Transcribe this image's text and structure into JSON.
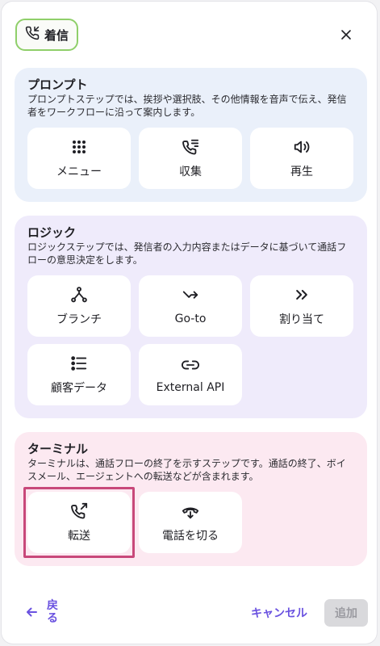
{
  "header": {
    "title": "着信"
  },
  "sections": {
    "prompt": {
      "title": "プロンプト",
      "description": "プロンプトステップでは、挨拶や選択肢、その他情報を音声で伝え、発信者をワークフローに沿って案内します。",
      "items": [
        {
          "label": "メニュー",
          "icon": "grid-dots-icon"
        },
        {
          "label": "収集",
          "icon": "phone-keypad-icon"
        },
        {
          "label": "再生",
          "icon": "speaker-icon"
        }
      ]
    },
    "logic": {
      "title": "ロジック",
      "description": "ロジックステップでは、発信者の入力内容またはデータに基づいて通話フローの意思決定をします。",
      "items": [
        {
          "label": "ブランチ",
          "icon": "branch-icon"
        },
        {
          "label": "Go-to",
          "icon": "goto-arrow-icon"
        },
        {
          "label": "割り当て",
          "icon": "double-chevron-icon"
        },
        {
          "label": "顧客データ",
          "icon": "list-icon"
        },
        {
          "label": "External API",
          "icon": "link-icon"
        }
      ]
    },
    "terminal": {
      "title": "ターミナル",
      "description": "ターミナルは、通話フローの終了を示すステップです。通話の終了、ボイスメール、エージェントへの転送などが含まれます。",
      "items": [
        {
          "label": "転送",
          "icon": "phone-forward-icon",
          "selected": true
        },
        {
          "label": "電話を切る",
          "icon": "hang-up-icon"
        }
      ]
    }
  },
  "footer": {
    "back_label": "戻る",
    "cancel_label": "キャンセル",
    "add_label": "追加"
  },
  "colors": {
    "accent": "#6a52e0",
    "selected_border": "#c8487a",
    "badge_border": "#8fcf6a"
  }
}
